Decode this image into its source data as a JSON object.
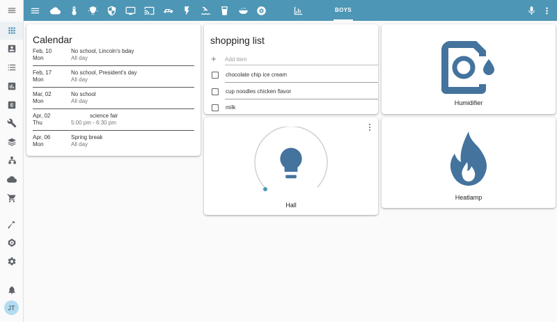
{
  "colors": {
    "accent": "#4e96b5",
    "entity_icon": "#44739e",
    "avatar_bg": "#b3dcf2"
  },
  "sidebar": {
    "menu_icon": "menu-icon",
    "items": [
      {
        "icon": "grid-icon",
        "active": true
      },
      {
        "icon": "account-box-icon"
      },
      {
        "icon": "list-icon"
      },
      {
        "icon": "chart-icon"
      },
      {
        "icon": "c-box-icon"
      },
      {
        "icon": "wrench-icon"
      },
      {
        "icon": "layers-icon"
      },
      {
        "icon": "sitemap-icon"
      },
      {
        "icon": "cloud-icon"
      },
      {
        "icon": "cart-icon"
      },
      {
        "icon": "hammer-icon"
      },
      {
        "icon": "hubspot-icon"
      },
      {
        "icon": "settings-icon"
      },
      {
        "icon": "bell-icon"
      }
    ],
    "user_initials": "JT"
  },
  "topbar": {
    "menu_icon": "menu-icon",
    "view_icons": [
      "cloud-icon",
      "thermometer-icon",
      "lightbulb-icon",
      "shield-icon",
      "monitor-icon",
      "cast-icon",
      "car-icon",
      "flash-icon",
      "pool-icon",
      "cup-icon",
      "bowl-icon",
      "settings-cycle-icon",
      "chart-view-icon"
    ],
    "active_tab": "BOYS",
    "right_icons": [
      "microphone-icon",
      "more-vert-icon"
    ]
  },
  "calendar": {
    "title": "Calendar",
    "events": [
      {
        "date": "Feb, 10",
        "day": "Mon",
        "title": "No school, Lincoln's bday",
        "time": "All day"
      },
      {
        "date": "Feb, 17",
        "day": "Mon",
        "title": "No school, President's day",
        "time": "All day"
      },
      {
        "date": "Mar, 02",
        "day": "Mon",
        "title": "No school",
        "time": "All day"
      },
      {
        "date": "Apr, 02",
        "day": "Thu",
        "title": "science fair",
        "time": "5:00 pm - 6:30 pm"
      },
      {
        "date": "Apr, 06",
        "day": "Mon",
        "title": "Spring break",
        "time": "All day"
      }
    ]
  },
  "shopping_list": {
    "title": "shopping list",
    "add_placeholder": "Add item",
    "items": [
      "chocolate chip ice cream",
      "cup noodles chicken flavor",
      "milk"
    ]
  },
  "light": {
    "name": "Hall",
    "brightness": 0.0
  },
  "humidifier": {
    "name": "Humidifier"
  },
  "heatlamp": {
    "name": "Heatlamp"
  }
}
